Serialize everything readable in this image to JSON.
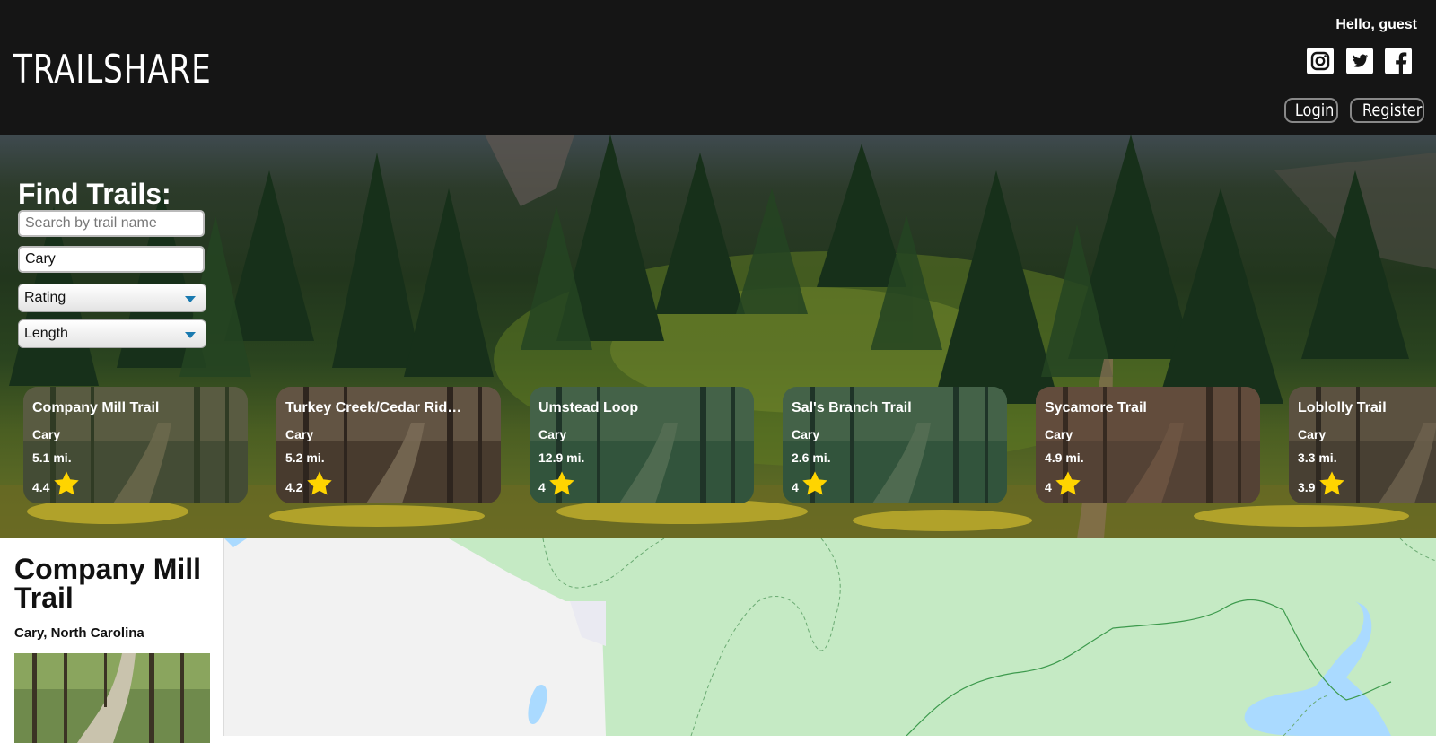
{
  "header": {
    "logo": "TRAILSHARE",
    "greeting": "Hello, guest",
    "social": [
      {
        "icon": "instagram-icon"
      },
      {
        "icon": "twitter-icon"
      },
      {
        "icon": "facebook-icon"
      }
    ],
    "login_label": "Login",
    "register_label": "Register"
  },
  "search": {
    "title": "Find Trails:",
    "name_placeholder": "Search by trail name",
    "city_value": "Cary",
    "rating_label": "Rating",
    "length_label": "Length"
  },
  "trails": [
    {
      "name": "Company Mill Trail",
      "city": "Cary",
      "length": "5.1 mi.",
      "rating": "4.4"
    },
    {
      "name": "Turkey Creek/Cedar Ridge Trail",
      "city": "Cary",
      "length": "5.2 mi.",
      "rating": "4.2"
    },
    {
      "name": "Umstead Loop",
      "city": "Cary",
      "length": "12.9 mi.",
      "rating": "4"
    },
    {
      "name": "Sal's Branch Trail",
      "city": "Cary",
      "length": "2.6 mi.",
      "rating": "4"
    },
    {
      "name": "Sycamore Trail",
      "city": "Cary",
      "length": "4.9 mi.",
      "rating": "4"
    },
    {
      "name": "Loblolly Trail",
      "city": "Cary",
      "length": "3.3 mi.",
      "rating": "3.9"
    }
  ],
  "selected": {
    "name": "Company Mill Trail",
    "location": "Cary, North Carolina"
  },
  "colors": {
    "header_bg": "#151515",
    "star": "#ffd400",
    "map_park": "#c5eac4",
    "map_land": "#f2f2f2",
    "map_water": "#aadaff"
  }
}
